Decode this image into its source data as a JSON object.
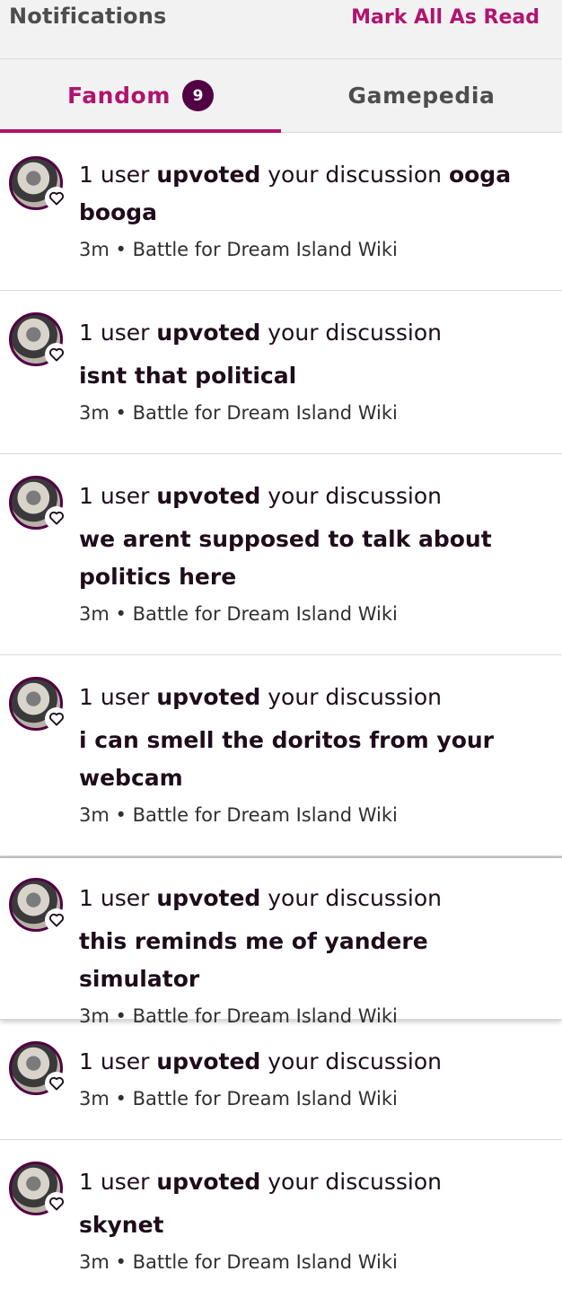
{
  "header": {
    "title": "Notifications",
    "mark_all": "Mark All As Read"
  },
  "tabs": [
    {
      "label": "Fandom",
      "badge": "9"
    },
    {
      "label": "Gamepedia"
    }
  ],
  "notification_text": {
    "prefix": "1 user",
    "action": "upvoted",
    "suffix": "your discussion"
  },
  "notifications": [
    {
      "title": "ooga",
      "title_cont": "booga",
      "time": "3m",
      "wiki": "Battle for Dream Island Wiki"
    },
    {
      "title": "isnt that political",
      "time": "3m",
      "wiki": "Battle for Dream Island Wiki"
    },
    {
      "title": "we arent supposed to talk about",
      "title_cont": "politics here",
      "time": "3m",
      "wiki": "Battle for Dream Island Wiki"
    },
    {
      "title": "i can smell the doritos from your",
      "title_cont": "webcam",
      "time": "3m",
      "wiki": "Battle for Dream Island Wiki"
    },
    {
      "title": "this reminds me of yandere simulator",
      "time": "3m",
      "wiki": "Battle for Dream Island Wiki"
    },
    {
      "title": "",
      "time": "3m",
      "wiki": "Battle for Dream Island Wiki"
    },
    {
      "title": "skynet",
      "time": "3m",
      "wiki": "Battle for Dream Island Wiki"
    }
  ],
  "meta_separator": "•",
  "colors": {
    "accent": "#b0136f",
    "badge": "#520044",
    "text": "#1e0c1b"
  },
  "icons": {
    "avatar_badge": "heart-icon"
  }
}
